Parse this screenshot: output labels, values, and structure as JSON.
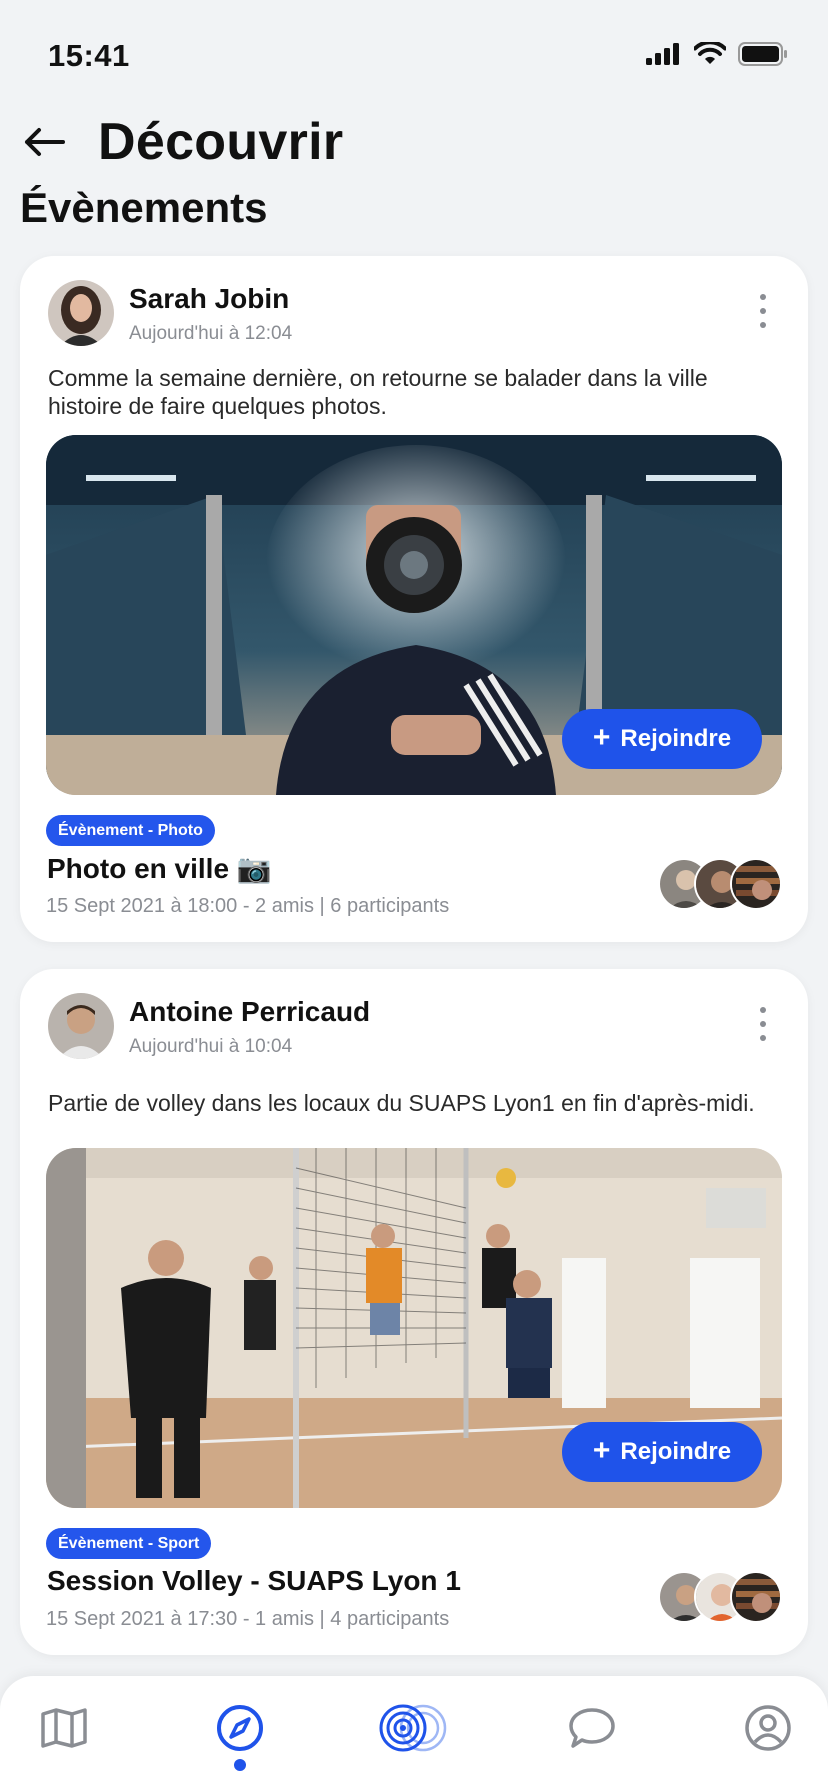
{
  "status_bar": {
    "time": "15:41"
  },
  "header": {
    "title": "Découvrir",
    "section": "Évènements"
  },
  "posts": [
    {
      "author": "Sarah Jobin",
      "timestamp": "Aujourd'hui à 12:04",
      "text": "Comme la semaine dernière, on retourne se balader dans la ville histoire de faire quelques photos.",
      "join_label": "Rejoindre",
      "badge": "Évènement - Photo",
      "event_title": "Photo en ville 📷",
      "event_meta": "15 Sept 2021 à 18:00 - 2 amis | 6 participants"
    },
    {
      "author": "Antoine Perricaud",
      "timestamp": "Aujourd'hui à 10:04",
      "text": "Partie de volley dans les locaux du SUAPS Lyon1  en fin d'après-midi.",
      "join_label": "Rejoindre",
      "badge": "Évènement - Sport",
      "event_title": "Session Volley - SUAPS Lyon 1",
      "event_meta": "15 Sept 2021 à 17:30 - 1 amis | 4 participants"
    }
  ],
  "nav": {
    "items": [
      "map-icon",
      "compass-icon",
      "radar-icon",
      "chat-bubble-icon",
      "profile-icon"
    ],
    "active": "compass-icon",
    "accent_color": "#1f53ea"
  }
}
